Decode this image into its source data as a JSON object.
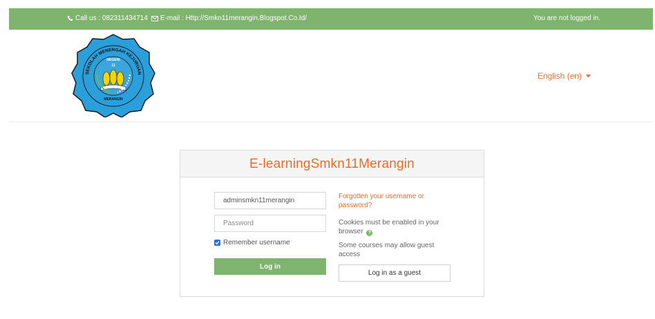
{
  "topbar": {
    "contact": "Call us : 082311434714",
    "email": "E-mail : Http://Smkn11merangin.Blogspot.Co.Id/",
    "login_status": "You are not logged in."
  },
  "header": {
    "logo_text_top": "SEKOLAH MENENGAH KEJURUAN",
    "logo_text_negeri": "NEGERI",
    "logo_text_number": "11",
    "logo_text_bottom": "MERANGIN",
    "language": "English (en)"
  },
  "login": {
    "title": "E-learningSmkn11Merangin",
    "username_value": "adminsmkn11merangin",
    "password_placeholder": "Password",
    "remember_label": "Remember username",
    "login_button": "Log in",
    "forgot_link": "Forgotten your username or password?",
    "cookies_text": "Cookies must be enabled in your browser",
    "guest_text": "Some courses may allow guest access",
    "guest_button": "Log in as a guest"
  },
  "colors": {
    "green": "#7fb46e",
    "orange": "#f06b2a",
    "logo_blue": "#2b9fd9",
    "logo_yellow": "#f2d600"
  }
}
